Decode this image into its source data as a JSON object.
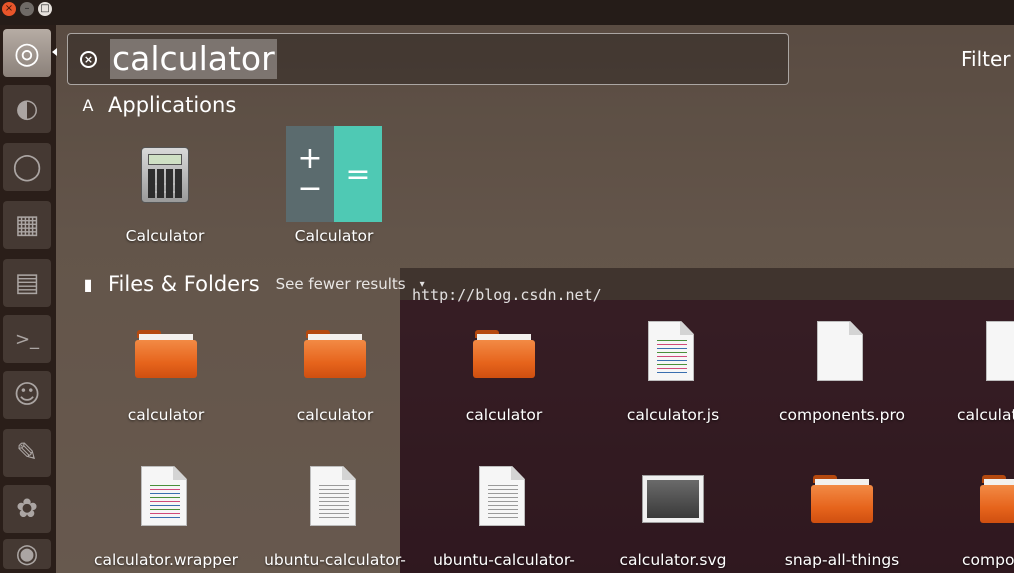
{
  "window_controls": {
    "close": "×",
    "minimize": "–",
    "maximize": "□"
  },
  "launcher": {
    "items": [
      {
        "name": "dash-home",
        "glyph": "◎"
      },
      {
        "name": "firefox",
        "glyph": "◐"
      },
      {
        "name": "chromium",
        "glyph": "◯"
      },
      {
        "name": "sdk",
        "glyph": "▦"
      },
      {
        "name": "files",
        "glyph": "▤"
      },
      {
        "name": "terminal",
        "glyph": ">_"
      },
      {
        "name": "gimp",
        "glyph": "☺"
      },
      {
        "name": "editor",
        "glyph": "✎"
      },
      {
        "name": "gnome",
        "glyph": "✿"
      },
      {
        "name": "disc",
        "glyph": "◉"
      }
    ]
  },
  "search": {
    "query": "calculator",
    "clear_icon": "×"
  },
  "filter_label": "Filter",
  "applications": {
    "title": "Applications",
    "icon": "A",
    "items": [
      {
        "label": "Calculator",
        "icon": "calculator-grey-icon"
      },
      {
        "label": "Calculator",
        "icon": "calculator-teal-icon",
        "plus": "+",
        "minus": "−",
        "equals": "="
      }
    ]
  },
  "files": {
    "title": "Files & Folders",
    "icon": "▮",
    "more_label": "See fewer results",
    "more_caret": "▾",
    "items": [
      {
        "label": "calculator",
        "icon": "folder"
      },
      {
        "label": "calculator",
        "icon": "folder"
      },
      {
        "label": "calculator",
        "icon": "folder"
      },
      {
        "label": "calculator.js",
        "icon": "code-file"
      },
      {
        "label": "components.pro",
        "icon": "blank-file"
      },
      {
        "label": "calculat",
        "icon": "blank-file"
      },
      {
        "label": "calculator.wrapper",
        "icon": "code-file"
      },
      {
        "label": "ubuntu-calculator-",
        "icon": "text-file"
      },
      {
        "label": "ubuntu-calculator-",
        "icon": "text-file"
      },
      {
        "label": "calculator.svg",
        "icon": "image-file"
      },
      {
        "label": "snap-all-things",
        "icon": "folder"
      },
      {
        "label": "compo",
        "icon": "folder"
      }
    ]
  },
  "watermark": "http://blog.csdn.net/"
}
